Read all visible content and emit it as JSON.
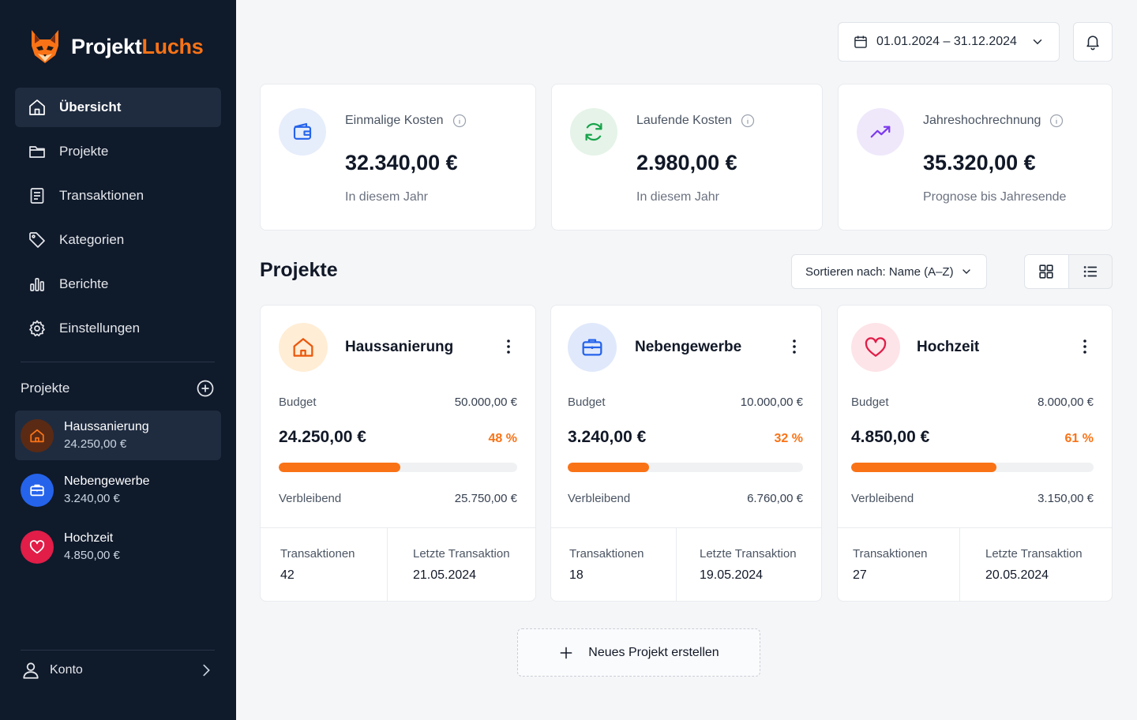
{
  "app": {
    "brand_part1": "Projekt",
    "brand_part2": "Luchs",
    "accent_color": "#f97316",
    "sidebar_bg": "#0f1a2b"
  },
  "sidebar": {
    "nav": [
      {
        "label": "Übersicht",
        "icon": "home-icon",
        "active": true
      },
      {
        "label": "Projekte",
        "icon": "folder-icon"
      },
      {
        "label": "Transaktionen",
        "icon": "document-list-icon"
      },
      {
        "label": "Kategorien",
        "icon": "tag-icon"
      },
      {
        "label": "Berichte",
        "icon": "bar-chart-icon"
      },
      {
        "label": "Einstellungen",
        "icon": "gear-icon"
      }
    ],
    "projects_heading": "Projekte",
    "projects": [
      {
        "name": "Haussanierung",
        "amount": "24.250,00 €",
        "icon": "house-icon",
        "color": "#c2410c"
      },
      {
        "name": "Nebengewerbe",
        "amount": "3.240,00 €",
        "icon": "briefcase-icon",
        "color": "#2563eb"
      },
      {
        "name": "Hochzeit",
        "amount": "4.850,00 €",
        "icon": "heart-icon",
        "color": "#e11d48"
      }
    ],
    "account_label": "Konto"
  },
  "topbar": {
    "date_range": "01.01.2024 – 31.12.2024"
  },
  "stats": [
    {
      "label": "Einmalige Kosten",
      "value": "32.340,00 €",
      "sub": "In diesem Jahr",
      "icon": "wallet-icon",
      "color": "#2563eb"
    },
    {
      "label": "Laufende Kosten",
      "value": "2.980,00 €",
      "sub": "In diesem Jahr",
      "icon": "refresh-icon",
      "color": "#16a34a"
    },
    {
      "label": "Jahreshochrechnung",
      "value": "35.320,00 €",
      "sub": "Prognose bis Jahresende",
      "icon": "trend-up-icon",
      "color": "#7c3aed"
    }
  ],
  "projects_section": {
    "title": "Projekte",
    "sort_label": "Sortieren nach: Name (A–Z)",
    "new_project_label": "Neues Projekt erstellen"
  },
  "project_labels": {
    "budget": "Budget",
    "remaining": "Verbleibend",
    "transactions": "Transaktionen",
    "last_transaction": "Letzte Transaktion"
  },
  "project_cards": [
    {
      "name": "Haussanierung",
      "budget": "50.000,00 €",
      "spent": "24.250,00 €",
      "percent_label": "48 %",
      "progress": 0.51,
      "remaining": "25.750,00 €",
      "transactions": "42",
      "last_transaction": "21.05.2024",
      "icon": "house-icon",
      "color": "#ea580c",
      "bg": "#ffedd5"
    },
    {
      "name": "Nebengewerbe",
      "budget": "10.000,00 €",
      "spent": "3.240,00 €",
      "percent_label": "32 %",
      "progress": 0.345,
      "remaining": "6.760,00 €",
      "transactions": "18",
      "last_transaction": "19.05.2024",
      "icon": "briefcase-icon",
      "color": "#2563eb",
      "bg": "#e0e9fb"
    },
    {
      "name": "Hochzeit",
      "budget": "8.000,00 €",
      "spent": "4.850,00 €",
      "percent_label": "61 %",
      "progress": 0.6,
      "remaining": "3.150,00 €",
      "transactions": "27",
      "last_transaction": "20.05.2024",
      "icon": "heart-icon",
      "color": "#e11d48",
      "bg": "#fde4e8"
    }
  ]
}
